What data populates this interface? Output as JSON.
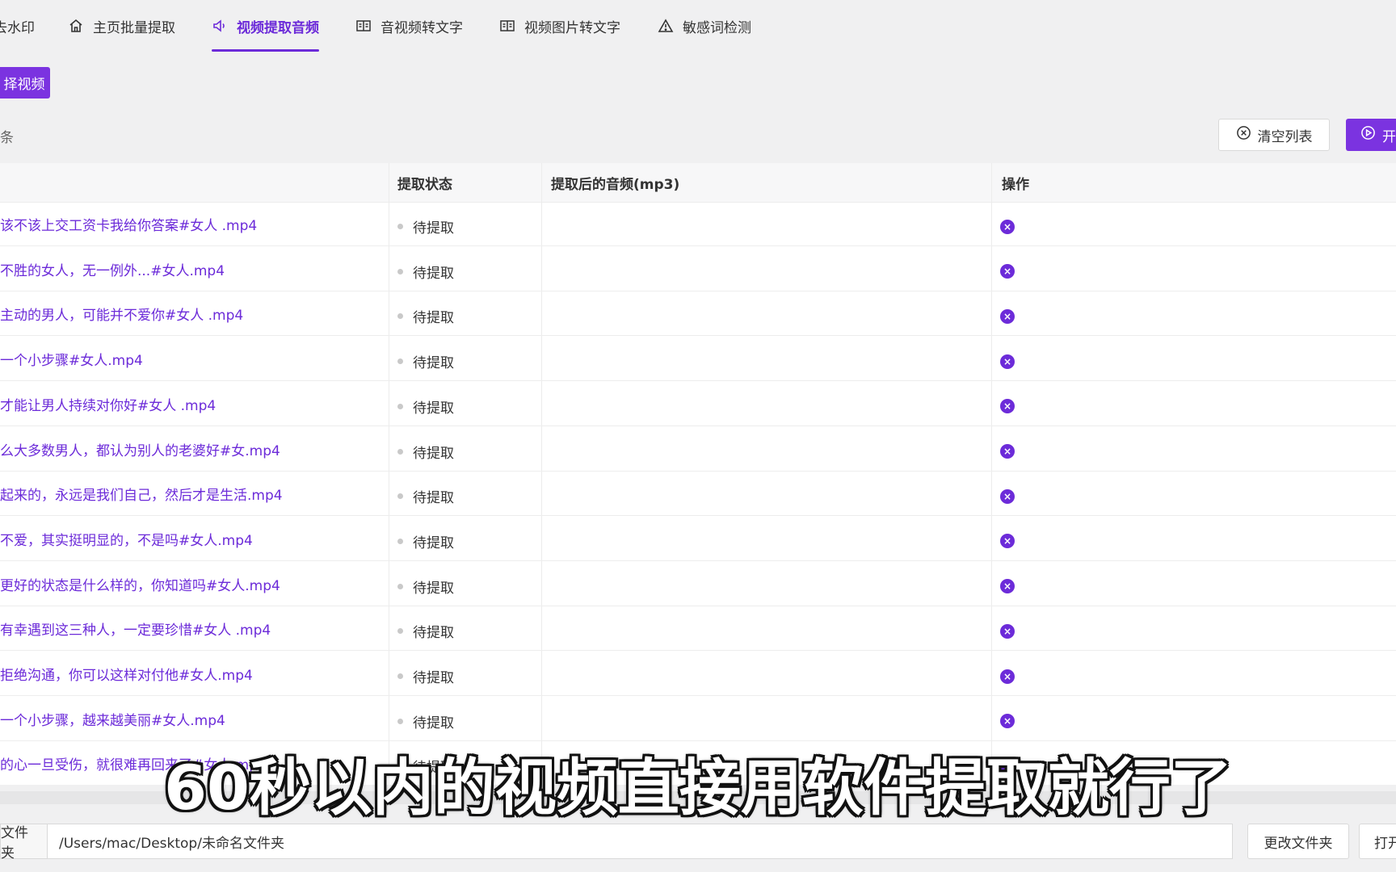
{
  "nav": {
    "tabs": [
      {
        "label": "去水印",
        "icon": "partial-icon",
        "active": false
      },
      {
        "label": "主页批量提取",
        "icon": "home-icon",
        "active": false
      },
      {
        "label": "视频提取音频",
        "icon": "speaker-icon",
        "active": true
      },
      {
        "label": "音视频转文字",
        "icon": "book-icon",
        "active": false
      },
      {
        "label": "视频图片转文字",
        "icon": "book-icon",
        "active": false
      },
      {
        "label": "敏感词检测",
        "icon": "warning-icon",
        "active": false
      }
    ]
  },
  "toolbar": {
    "select_video_label": "择视频",
    "count_text": "条",
    "clear_list_label": "清空列表",
    "start_label": "开"
  },
  "table": {
    "headers": {
      "status": "提取状态",
      "audio": "提取后的音频(mp3)",
      "action": "操作"
    },
    "rows": [
      {
        "name": "该不该上交工资卡我给你答案#女人 .mp4",
        "status": "待提取"
      },
      {
        "name": "不胜的女人，无一例外...#女人.mp4",
        "status": "待提取"
      },
      {
        "name": "主动的男人，可能并不爱你#女人 .mp4",
        "status": "待提取"
      },
      {
        "name": "一个小步骤#女人.mp4",
        "status": "待提取"
      },
      {
        "name": "才能让男人持续对你好#女人 .mp4",
        "status": "待提取"
      },
      {
        "name": "么大多数男人，都认为别人的老婆好#女.mp4",
        "status": "待提取"
      },
      {
        "name": "起来的，永远是我们自己，然后才是生活.mp4",
        "status": "待提取"
      },
      {
        "name": "不爱，其实挺明显的，不是吗#女人.mp4",
        "status": "待提取"
      },
      {
        "name": "更好的状态是什么样的，你知道吗#女人.mp4",
        "status": "待提取"
      },
      {
        "name": "有幸遇到这三种人，一定要珍惜#女人 .mp4",
        "status": "待提取"
      },
      {
        "name": "拒绝沟通，你可以这样对付他#女人.mp4",
        "status": "待提取"
      },
      {
        "name": "一个小步骤，越来越美丽#女人.mp4",
        "status": "待提取"
      },
      {
        "name": "的心一旦受伤，就很难再回来了#女人.mp4",
        "status": "待提取"
      }
    ]
  },
  "subtitle": "60秒以内的视频直接用软件提取就行了",
  "bottom": {
    "folder_label": "文件夹",
    "folder_path": "/Users/mac/Desktop/未命名文件夹",
    "change_folder_label": "更改文件夹",
    "open_label": "打开"
  },
  "colors": {
    "accent": "#7b33e0",
    "accent_text": "#6c2bd9",
    "background": "#f0f0f1"
  }
}
